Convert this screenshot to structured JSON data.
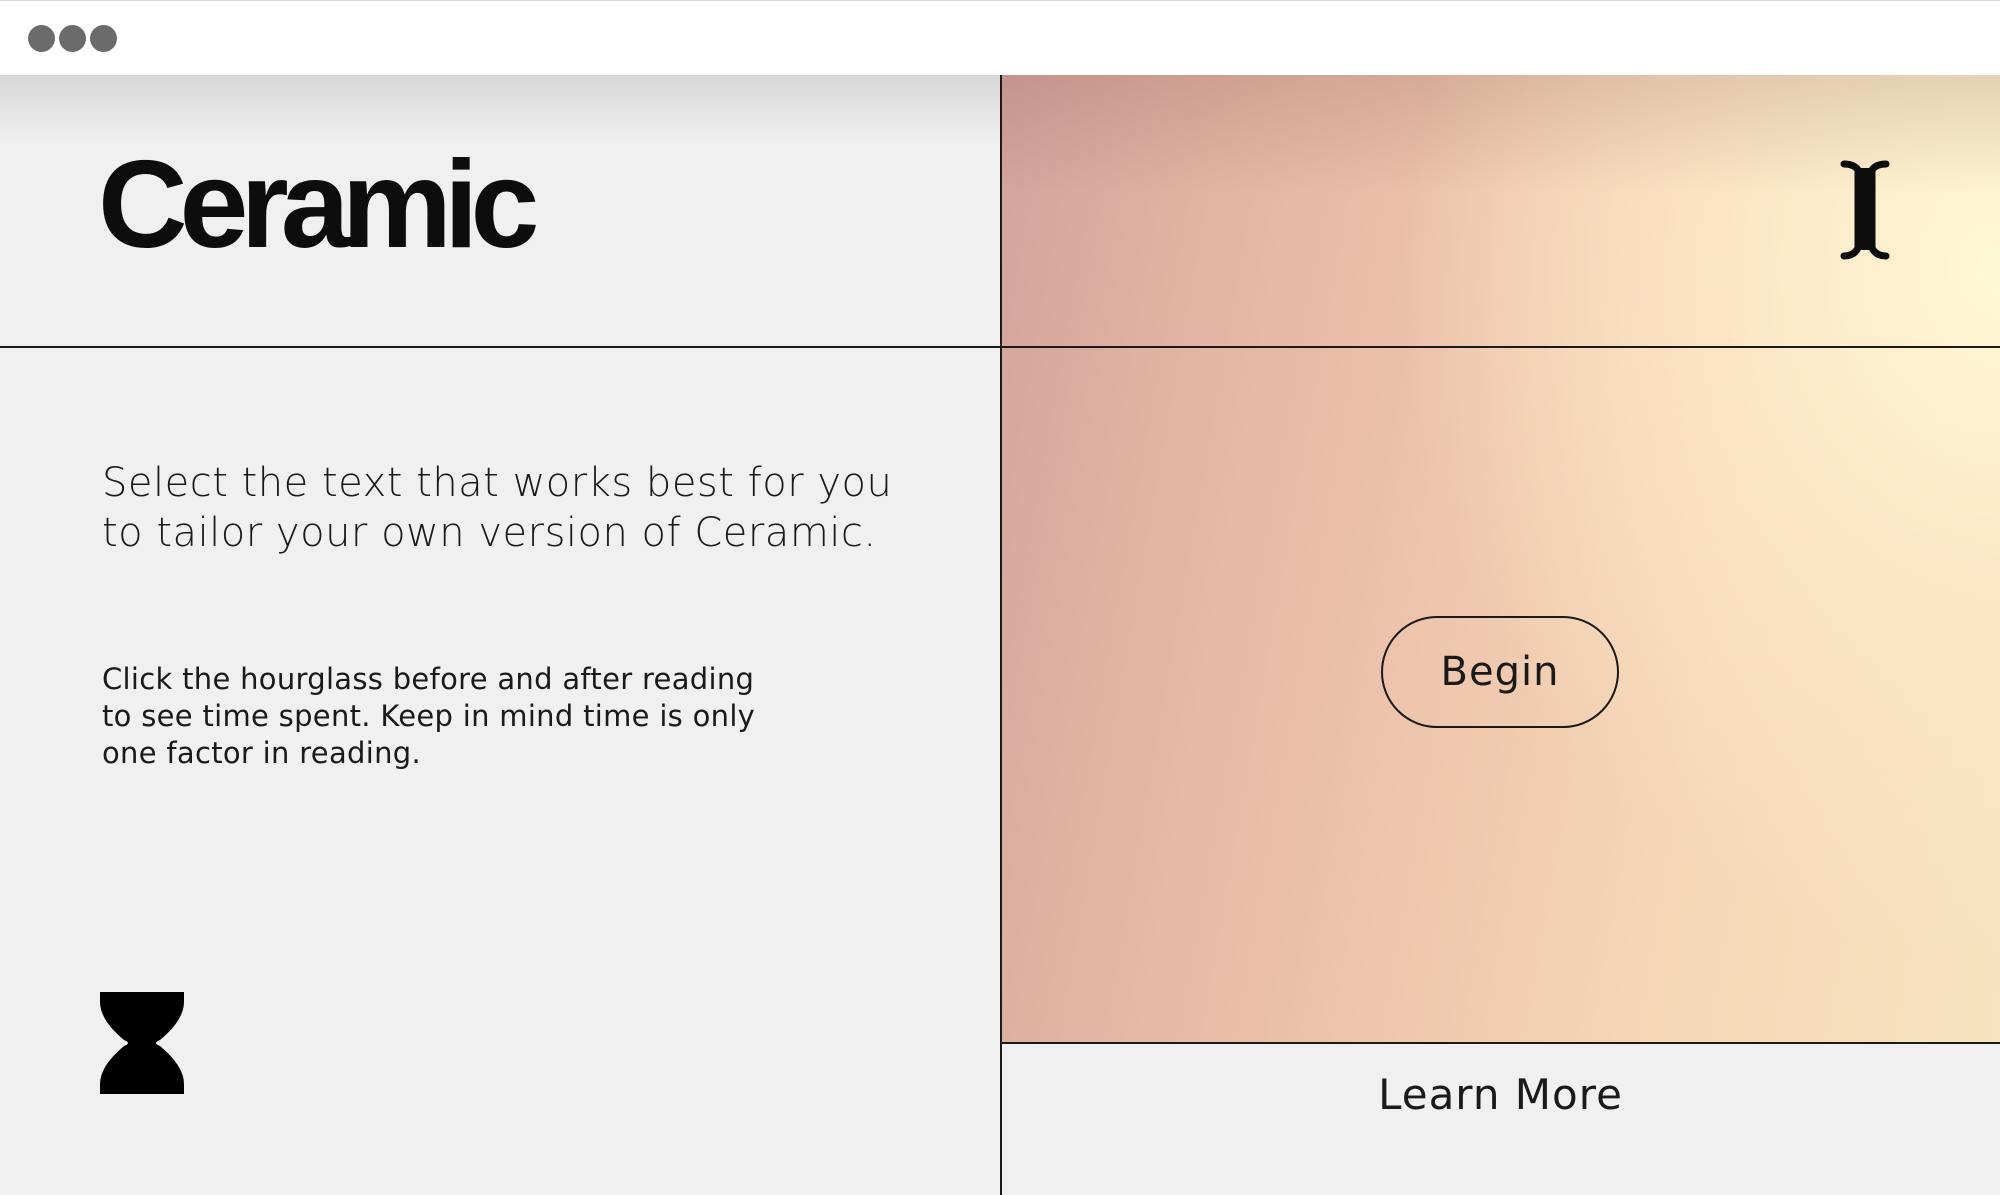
{
  "browser": {
    "window_controls": [
      "window-dot",
      "window-dot",
      "window-dot"
    ]
  },
  "header": {
    "logo_text": "Ceramic",
    "cursor_icon": "text-cursor-icon"
  },
  "intro": {
    "headline": "Select the text that works best for you to tailor your own version of Ceramic.",
    "instructions": "Click the hourglass before and after reading to see time spent. Keep in mind time is only one factor in reading.",
    "hourglass_icon": "hourglass-icon"
  },
  "panel": {
    "begin_label": "Begin",
    "learn_more_label": "Learn More"
  },
  "colors": {
    "page_background": "#f0f0f0",
    "text": "#1a1a1a",
    "gradient_left": "#d3a39c",
    "gradient_right": "#f8e3bf",
    "gradient_highlight": "#fff8d6"
  }
}
